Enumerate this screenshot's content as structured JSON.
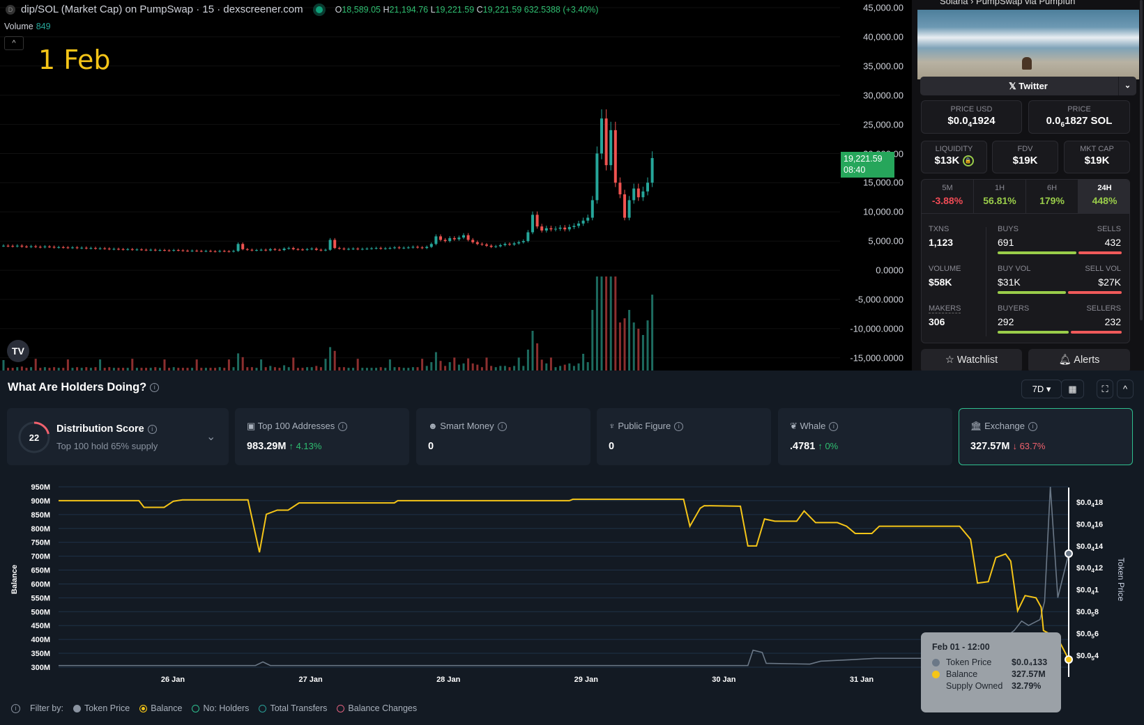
{
  "header": {
    "title": "dip/SOL (Market Cap) on PumpSwap · 15 · dexscreener.com",
    "open_label": "O",
    "open": "18,589.05",
    "high_label": "H",
    "high": "21,194.76",
    "low_label": "L",
    "low": "19,221.59",
    "close_label": "C",
    "close": "19,221.59",
    "change": "632.5388 (+3.40%)",
    "volume_label": "Volume",
    "volume": "849",
    "date_annotation": "1 Feb"
  },
  "price_axis": [
    "45,000.00",
    "40,000.00",
    "35,000.00",
    "30,000.00",
    "25,000.00",
    "20,000.00",
    "15,000.00",
    "10,000.00",
    "5,000.00",
    "0.0000",
    "-5,000.0000",
    "-10,000.0000",
    "-15,000.0000"
  ],
  "price_tag": {
    "value": "19,221.59",
    "countdown": "08:40"
  },
  "chart_data": [
    {
      "type": "candlestick",
      "title": "dip/SOL (Market Cap)",
      "interval": "15",
      "ylim": [
        -15000,
        45000
      ],
      "closes_k": [
        4.2,
        4.15,
        4.1,
        4.2,
        4.05,
        4.0,
        4.1,
        4.0,
        3.95,
        4.05,
        4.0,
        3.9,
        3.95,
        3.9,
        3.85,
        3.9,
        3.8,
        3.85,
        3.75,
        3.8,
        3.7,
        3.75,
        3.7,
        3.6,
        3.65,
        3.6,
        3.55,
        3.6,
        3.5,
        3.55,
        3.5,
        3.45,
        3.5,
        3.4,
        3.45,
        3.4,
        3.35,
        3.45,
        3.4,
        3.35,
        3.3,
        3.35,
        3.3,
        3.25,
        3.3,
        3.25,
        3.2,
        3.3,
        3.25,
        3.2,
        3.3,
        4.5,
        3.6,
        3.5,
        3.4,
        3.45,
        3.5,
        3.4,
        3.6,
        3.5,
        3.45,
        3.7,
        3.8,
        3.6,
        3.55,
        3.5,
        3.6,
        3.7,
        3.5,
        3.4,
        3.5,
        5.2,
        3.8,
        3.7,
        3.6,
        3.65,
        3.7,
        3.6,
        3.65,
        3.7,
        3.75,
        3.8,
        3.7,
        3.75,
        3.8,
        3.9,
        3.8,
        3.85,
        3.9,
        4.0,
        3.9,
        3.8,
        4.0,
        4.5,
        5.8,
        5.2,
        5.0,
        5.5,
        5.3,
        5.6,
        6.0,
        5.2,
        4.8,
        4.5,
        4.4,
        4.2,
        4.0,
        4.1,
        4.3,
        4.5,
        4.4,
        4.6,
        4.8,
        5.0,
        6.5,
        9.5,
        7.5,
        6.8,
        7.2,
        7.0,
        7.1,
        7.3,
        7.0,
        7.4,
        7.6,
        8.0,
        8.5,
        9.0,
        12,
        20,
        26,
        18,
        24,
        15,
        13,
        9,
        12,
        14,
        12.5,
        13.5,
        15,
        19.22
      ]
    },
    {
      "type": "line",
      "title": "What Are Holders Doing?",
      "x_unit": "hours since 25 Jan 04:00",
      "xticks": [
        "26 Jan",
        "27 Jan",
        "28 Jan",
        "29 Jan",
        "30 Jan",
        "31 Jan"
      ],
      "left_axis": {
        "label": "Balance",
        "ticks": [
          "950M",
          "900M",
          "850M",
          "800M",
          "750M",
          "700M",
          "650M",
          "600M",
          "550M",
          "500M",
          "450M",
          "400M",
          "350M",
          "300M"
        ],
        "ylim_m": [
          300,
          950
        ]
      },
      "right_axis": {
        "label": "Token Price",
        "ticks": [
          {
            "p": "$0.0",
            "s": "4",
            "d": "18"
          },
          {
            "p": "$0.0",
            "s": "4",
            "d": "16"
          },
          {
            "p": "$0.0",
            "s": "4",
            "d": "14"
          },
          {
            "p": "$0.0",
            "s": "4",
            "d": "12"
          },
          {
            "p": "$0.0",
            "s": "4",
            "d": "1"
          },
          {
            "p": "$0.0",
            "s": "5",
            "d": "8"
          },
          {
            "p": "$0.0",
            "s": "5",
            "d": "6"
          },
          {
            "p": "$0.0",
            "s": "5",
            "d": "4"
          }
        ],
        "ylim_micro": [
          4,
          18
        ]
      },
      "series": [
        {
          "name": "Balance",
          "color": "#f5c518",
          "points": [
            [
              0,
              900
            ],
            [
              14,
              900
            ],
            [
              14.9,
              876
            ],
            [
              18.4,
              876
            ],
            [
              20,
              898
            ],
            [
              21.6,
              903
            ],
            [
              33,
              903
            ],
            [
              35,
              714
            ],
            [
              36.2,
              851
            ],
            [
              38.1,
              866
            ],
            [
              40,
              866
            ],
            [
              41.9,
              892
            ],
            [
              43.2,
              892
            ],
            [
              58.5,
              892
            ],
            [
              59.1,
              900
            ],
            [
              89,
              900
            ],
            [
              89.6,
              905
            ],
            [
              108.9,
              905
            ],
            [
              110,
              808
            ],
            [
              111.8,
              873
            ],
            [
              112.5,
              882
            ],
            [
              118.8,
              880
            ],
            [
              120.1,
              737
            ],
            [
              121.6,
              737
            ],
            [
              123,
              834
            ],
            [
              124.8,
              826
            ],
            [
              128.6,
              826
            ],
            [
              129.9,
              863
            ],
            [
              131.9,
              821
            ],
            [
              135.7,
              821
            ],
            [
              137.3,
              808
            ],
            [
              138.8,
              782
            ],
            [
              141.7,
              782
            ],
            [
              143,
              808
            ],
            [
              157,
              808
            ],
            [
              158.9,
              761
            ],
            [
              160.1,
              603
            ],
            [
              162,
              608
            ],
            [
              163.3,
              695
            ],
            [
              165,
              708
            ],
            [
              165.9,
              682
            ],
            [
              167.1,
              503
            ],
            [
              168.4,
              558
            ],
            [
              170.3,
              550
            ],
            [
              171.2,
              516
            ],
            [
              171.6,
              432
            ],
            [
              172.8,
              419
            ],
            [
              174.4,
              392
            ],
            [
              176,
              327.57
            ]
          ]
        },
        {
          "name": "Token Price",
          "color": "#6b7887",
          "points": [
            [
              0,
              3.07
            ],
            [
              34.3,
              3.07
            ],
            [
              35.6,
              3.4
            ],
            [
              36.9,
              3.07
            ],
            [
              120.1,
              3.07
            ],
            [
              121,
              4.47
            ],
            [
              122.6,
              4.27
            ],
            [
              123.3,
              3.27
            ],
            [
              130.9,
              3.2
            ],
            [
              132.8,
              3.47
            ],
            [
              137.9,
              3.6
            ],
            [
              142.3,
              3.73
            ],
            [
              160,
              3.73
            ],
            [
              166.5,
              6.27
            ],
            [
              167.8,
              7.13
            ],
            [
              169,
              6.73
            ],
            [
              171,
              7.27
            ],
            [
              171.8,
              8.93
            ],
            [
              172.8,
              19.4
            ],
            [
              174.1,
              9.27
            ],
            [
              176,
              13.3
            ]
          ]
        }
      ]
    }
  ],
  "sidebar": {
    "top_crumbs": "Solana  ›  PumpSwap  via  Pumpfun",
    "twitter_label": "Twitter",
    "price_usd": {
      "label": "PRICE USD",
      "prefix": "$0.0",
      "sub": "4",
      "suffix": "1924"
    },
    "price_sol": {
      "label": "PRICE",
      "prefix": "0.0",
      "sub": "6",
      "suffix": "1827 SOL"
    },
    "liquidity": {
      "label": "LIQUIDITY",
      "value": "$13K"
    },
    "fdv": {
      "label": "FDV",
      "value": "$19K"
    },
    "mktcap": {
      "label": "MKT CAP",
      "value": "$19K"
    },
    "timeframes": [
      {
        "label": "5M",
        "value": "-3.88%",
        "color": "#f04b55"
      },
      {
        "label": "1H",
        "value": "56.81%",
        "color": "#9acd4a"
      },
      {
        "label": "6H",
        "value": "179%",
        "color": "#9acd4a"
      },
      {
        "label": "24H",
        "value": "448%",
        "color": "#9acd4a"
      }
    ],
    "txns": {
      "label": "TXNS",
      "value": "1,123"
    },
    "buys": {
      "label": "BUYS",
      "value": "691"
    },
    "sells": {
      "label": "SELLS",
      "value": "432"
    },
    "volume": {
      "label": "VOLUME",
      "value": "$58K"
    },
    "buy_vol": {
      "label": "BUY VOL",
      "value": "$31K"
    },
    "sell_vol": {
      "label": "SELL VOL",
      "value": "$27K"
    },
    "makers": {
      "label": "MAKERS",
      "value": "306"
    },
    "buyers": {
      "label": "BUYERS",
      "value": "292"
    },
    "sellers": {
      "label": "SELLERS",
      "value": "232"
    },
    "watchlist_label": "Watchlist",
    "alerts_label": "Alerts"
  },
  "holders": {
    "title": "What Are Holders Doing?",
    "period": "7D",
    "distribution": {
      "score": "22",
      "title": "Distribution Score",
      "subtitle": "Top 100 hold 65% supply"
    },
    "cards": [
      {
        "title": "Top 100 Addresses",
        "value": "983.29M",
        "change": "↑ 4.13%",
        "dir": "up"
      },
      {
        "title": "Smart Money",
        "value": "0",
        "change": "",
        "dir": "up"
      },
      {
        "title": "Public Figure",
        "value": "0",
        "change": "",
        "dir": "up"
      },
      {
        "title": "Whale",
        "value": ".4781",
        "change": "↑ 0%",
        "dir": "up"
      },
      {
        "title": "Exchange",
        "value": "327.57M",
        "change": "↓ 63.7%",
        "dir": "dn"
      }
    ],
    "tooltip": {
      "date": "Feb 01 - 12:00",
      "price_label": "Token Price",
      "price_value": "$0.0₄133",
      "balance_label": "Balance",
      "balance_value": "327.57M",
      "supply_label": "Supply Owned",
      "supply_value": "32.79%"
    },
    "filter": {
      "label": "Filter by:",
      "items": [
        "Token Price",
        "Balance",
        "No: Holders",
        "Total Transfers",
        "Balance Changes"
      ]
    }
  }
}
